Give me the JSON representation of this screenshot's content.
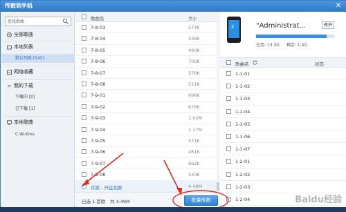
{
  "window": {
    "title": "传歌到手机",
    "close_glyph": "✕"
  },
  "sidebar": {
    "search_placeholder": "查找歌曲",
    "items": [
      {
        "label": "全部歌曲",
        "icon": "music-icon"
      },
      {
        "label": "本地列表",
        "icon": "folder-icon"
      },
      {
        "label": "默认列表 [545]",
        "icon": ""
      },
      {
        "label": "网络收藏",
        "icon": "cloud-icon"
      },
      {
        "label": "我的下载",
        "icon": "download-icon"
      },
      {
        "label": "下载中 [0]",
        "icon": ""
      },
      {
        "label": "已下载 [1]",
        "icon": ""
      },
      {
        "label": "本地歌曲",
        "icon": "computer-icon"
      },
      {
        "label": "C:\\KuGou",
        "icon": ""
      }
    ]
  },
  "songs": {
    "header": {
      "name": "歌曲名",
      "size": "大小"
    },
    "rows": [
      {
        "name": "7-8-03",
        "size": "574K"
      },
      {
        "name": "7-8-04",
        "size": "438K"
      },
      {
        "name": "7-8-05",
        "size": "490K"
      },
      {
        "name": "7-8-06",
        "size": "700K"
      },
      {
        "name": "7-8-07",
        "size": "576K"
      },
      {
        "name": "7-8-08",
        "size": "511K"
      },
      {
        "name": "7-9-01",
        "size": "698K"
      },
      {
        "name": "7-9-02",
        "size": "678K"
      },
      {
        "name": "7-9-03",
        "size": "1.02M"
      },
      {
        "name": "7-9-04",
        "size": "1.17M"
      },
      {
        "name": "7-9-05",
        "size": "571K"
      },
      {
        "name": "7-9-06",
        "size": "461K"
      },
      {
        "name": "7-9-07",
        "size": "862K"
      },
      {
        "name": "7-9-08",
        "size": "543K"
      },
      {
        "name": "许嵩 - 只往北欧",
        "size": "4.49M"
      }
    ],
    "footer": {
      "selected": "已选 1 首歌",
      "total": "共 4.49M",
      "transfer_button": "批量传歌"
    }
  },
  "device": {
    "name": "\"Administrat...",
    "rename_button": "改开",
    "used": "已用: 13.3G",
    "free": "剩余: 1.4G",
    "used_fraction": 0.9,
    "header": {
      "name": "歌曲名",
      "status": "状态"
    },
    "rows": [
      {
        "name": "1-1-01"
      },
      {
        "name": "1-1-02"
      },
      {
        "name": "1-1-03"
      },
      {
        "name": "1-1-04"
      },
      {
        "name": "1-1-05"
      },
      {
        "name": "1-1-06"
      },
      {
        "name": "1-1-07"
      },
      {
        "name": "1-2-01"
      },
      {
        "name": "1-2-02"
      },
      {
        "name": "1-2-03"
      },
      {
        "name": "1-2-04"
      }
    ]
  },
  "watermark": "Baidu经验",
  "colors": {
    "accent": "#2f82d6",
    "annotation_red": "#e0281e"
  }
}
